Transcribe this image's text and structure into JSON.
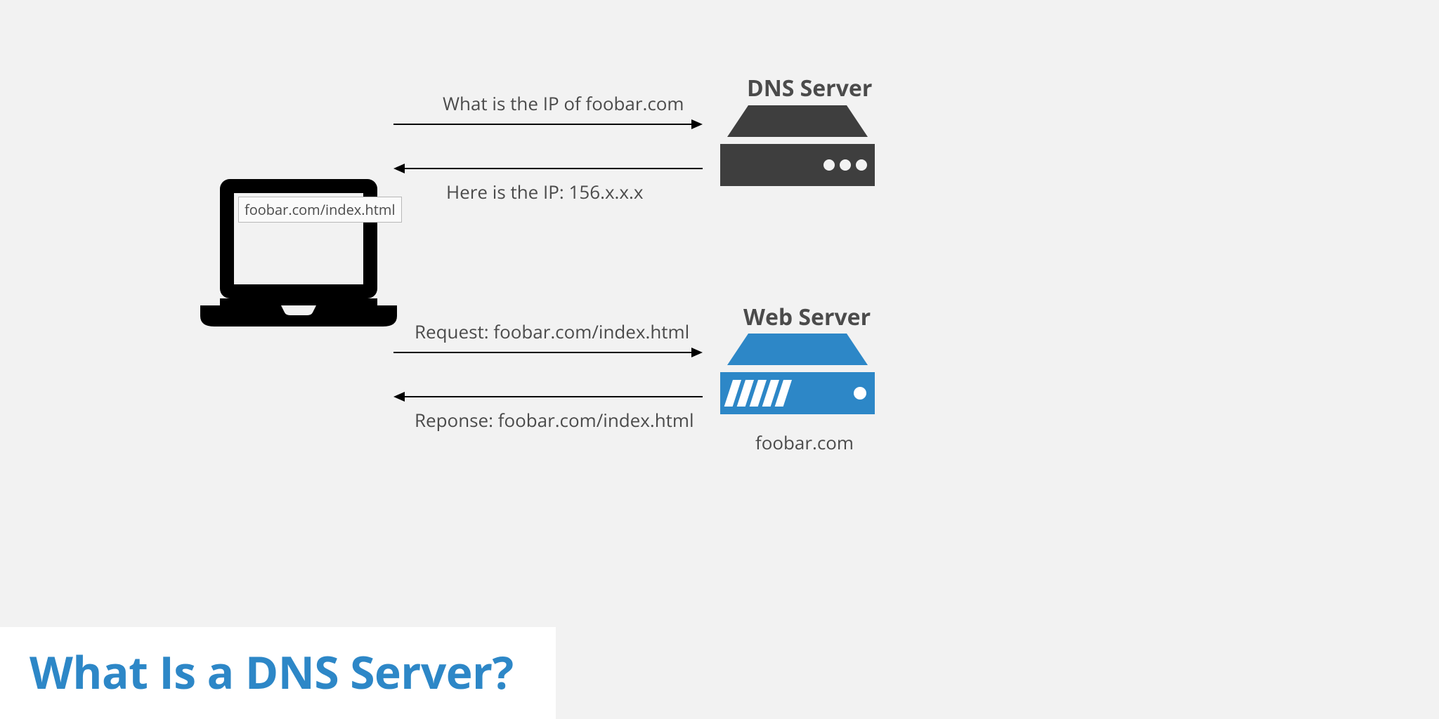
{
  "title": "What Is a DNS Server?",
  "laptop": {
    "url": "foobar.com/index.html"
  },
  "dns": {
    "label": "DNS Server",
    "request": "What is the IP of foobar.com",
    "response": "Here is the IP: 156.x.x.x"
  },
  "web": {
    "label": "Web Server",
    "caption": "foobar.com",
    "request": "Request: foobar.com/index.html",
    "response": "Reponse: foobar.com/index.html"
  },
  "colors": {
    "dark": "#3e3e3e",
    "blue": "#2d87c7",
    "bg": "#f2f2f2"
  }
}
